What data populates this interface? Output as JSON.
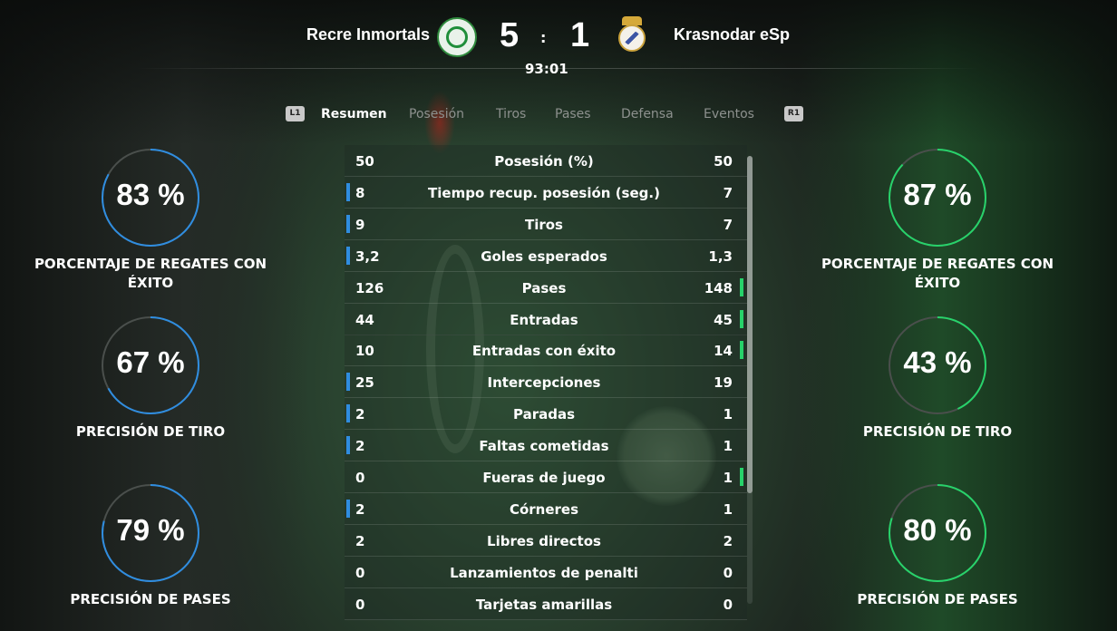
{
  "match": {
    "home_team": "Recre Inmortals",
    "away_team": "Krasnodar eSp",
    "home_score": "5",
    "score_separator": ":",
    "away_score": "1",
    "clock": "93:01"
  },
  "tabs": {
    "left_hint": "L1",
    "right_hint": "R1",
    "items": [
      "Resumen",
      "Posesión",
      "Tiros",
      "Pases",
      "Defensa",
      "Eventos"
    ],
    "active": "Resumen"
  },
  "stats": [
    {
      "label": "Posesión (%)",
      "home": "50",
      "away": "50",
      "leader": "none"
    },
    {
      "label": "Tiempo recup. posesión (seg.)",
      "home": "8",
      "away": "7",
      "leader": "home"
    },
    {
      "label": "Tiros",
      "home": "9",
      "away": "7",
      "leader": "home"
    },
    {
      "label": "Goles esperados",
      "home": "3,2",
      "away": "1,3",
      "leader": "home"
    },
    {
      "label": "Pases",
      "home": "126",
      "away": "148",
      "leader": "away"
    },
    {
      "label": "Entradas",
      "home": "44",
      "away": "45",
      "leader": "away"
    },
    {
      "label": "Entradas con éxito",
      "home": "10",
      "away": "14",
      "leader": "away"
    },
    {
      "label": "Intercepciones",
      "home": "25",
      "away": "19",
      "leader": "home"
    },
    {
      "label": "Paradas",
      "home": "2",
      "away": "1",
      "leader": "home"
    },
    {
      "label": "Faltas cometidas",
      "home": "2",
      "away": "1",
      "leader": "home"
    },
    {
      "label": "Fueras de juego",
      "home": "0",
      "away": "1",
      "leader": "away"
    },
    {
      "label": "Córneres",
      "home": "2",
      "away": "1",
      "leader": "home"
    },
    {
      "label": "Libres directos",
      "home": "2",
      "away": "2",
      "leader": "none"
    },
    {
      "label": "Lanzamientos de penalti",
      "home": "0",
      "away": "0",
      "leader": "none"
    },
    {
      "label": "Tarjetas amarillas",
      "home": "0",
      "away": "0",
      "leader": "none"
    }
  ],
  "home_gauges": [
    {
      "value": 83,
      "text": "83 %",
      "label": "PORCENTAJE DE REGATES CON ÉXITO"
    },
    {
      "value": 67,
      "text": "67 %",
      "label": "PRECISIÓN DE TIRO"
    },
    {
      "value": 79,
      "text": "79 %",
      "label": "PRECISIÓN DE PASES"
    }
  ],
  "away_gauges": [
    {
      "value": 87,
      "text": "87 %",
      "label": "PORCENTAJE DE REGATES CON ÉXITO"
    },
    {
      "value": 43,
      "text": "43 %",
      "label": "PRECISIÓN DE TIRO"
    },
    {
      "value": 80,
      "text": "80 %",
      "label": "PRECISIÓN DE PASES"
    }
  ],
  "colors": {
    "home_accent": "#2f8de0",
    "away_accent": "#27d36a",
    "gauge_track": "#4a4f4c"
  },
  "icons": {
    "home_crest": "celtic-crest-icon",
    "away_crest": "real-madrid-crest-icon"
  }
}
